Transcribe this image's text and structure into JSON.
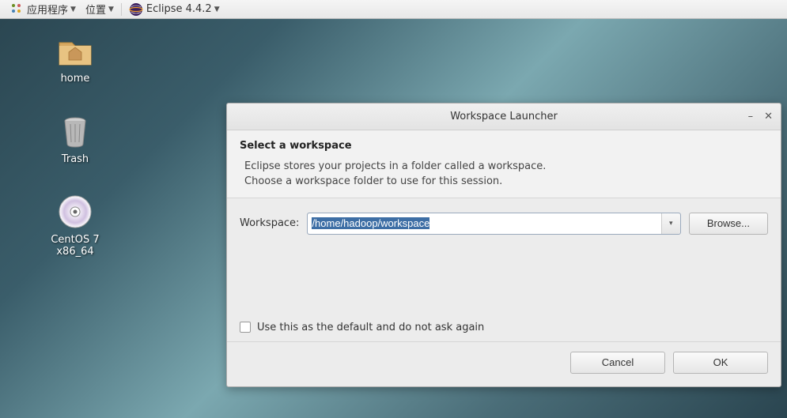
{
  "menubar": {
    "apps_label": "应用程序",
    "places_label": "位置",
    "active_app_label": "Eclipse 4.4.2"
  },
  "desktop": {
    "icons": [
      {
        "label": "home"
      },
      {
        "label": "Trash"
      },
      {
        "label": "CentOS 7 x86_64"
      }
    ]
  },
  "dialog": {
    "title": "Workspace Launcher",
    "header_title": "Select a workspace",
    "header_line1": "Eclipse stores your projects in a folder called a workspace.",
    "header_line2": "Choose a workspace folder to use for this session.",
    "workspace_label": "Workspace:",
    "workspace_value": "/home/hadoop/workspace",
    "browse_label": "Browse...",
    "checkbox_label": "Use this as the default and do not ask again",
    "cancel_label": "Cancel",
    "ok_label": "OK"
  }
}
